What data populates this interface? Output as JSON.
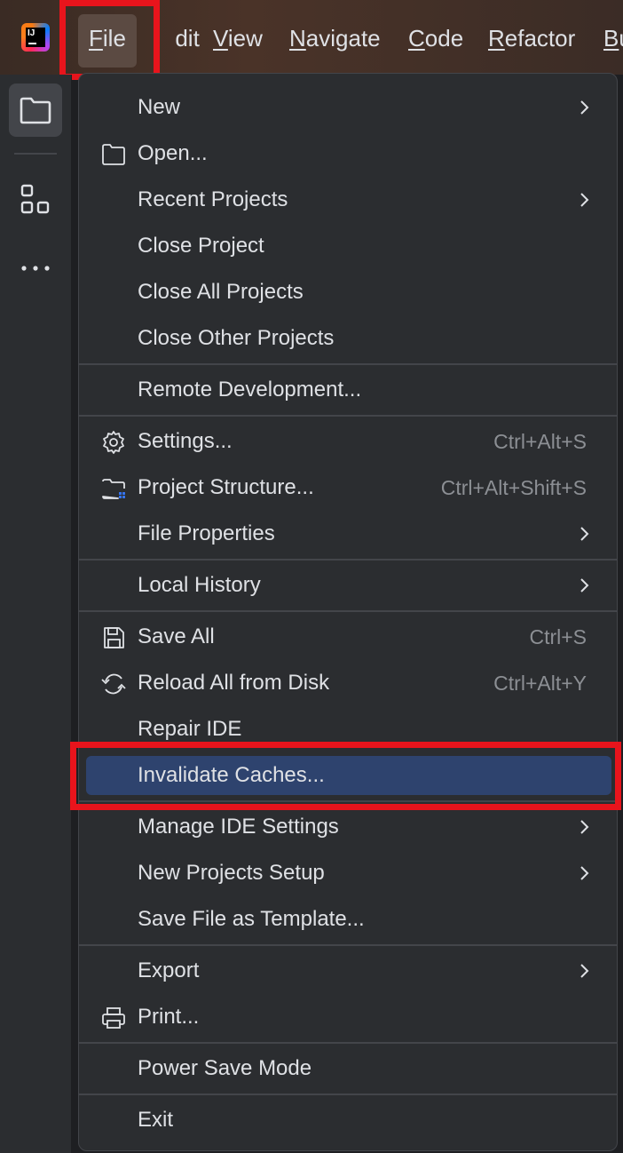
{
  "menubar": {
    "items": [
      {
        "label": "File",
        "mnemonic_index": 0
      },
      {
        "label": "Edit",
        "mnemonic_index": 0
      },
      {
        "label": "View",
        "mnemonic_index": 0
      },
      {
        "label": "Navigate",
        "mnemonic_index": 0
      },
      {
        "label": "Code",
        "mnemonic_index": 0
      },
      {
        "label": "Refactor",
        "mnemonic_index": 0
      },
      {
        "label": "Bu",
        "mnemonic_index": 0
      }
    ],
    "logo_text": "IJ"
  },
  "file_menu": {
    "groups": [
      [
        {
          "label": "New",
          "icon": null,
          "submenu": true,
          "shortcut": ""
        },
        {
          "label": "Open...",
          "icon": "folder-icon",
          "submenu": false,
          "shortcut": ""
        },
        {
          "label": "Recent Projects",
          "icon": null,
          "submenu": true,
          "shortcut": ""
        },
        {
          "label": "Close Project",
          "icon": null,
          "submenu": false,
          "shortcut": ""
        },
        {
          "label": "Close All Projects",
          "icon": null,
          "submenu": false,
          "shortcut": ""
        },
        {
          "label": "Close Other Projects",
          "icon": null,
          "submenu": false,
          "shortcut": ""
        }
      ],
      [
        {
          "label": "Remote Development...",
          "icon": null,
          "submenu": false,
          "shortcut": ""
        }
      ],
      [
        {
          "label": "Settings...",
          "icon": "gear-icon",
          "submenu": false,
          "shortcut": "Ctrl+Alt+S"
        },
        {
          "label": "Project Structure...",
          "icon": "project-structure-icon",
          "submenu": false,
          "shortcut": "Ctrl+Alt+Shift+S"
        },
        {
          "label": "File Properties",
          "icon": null,
          "submenu": true,
          "shortcut": ""
        }
      ],
      [
        {
          "label": "Local History",
          "icon": null,
          "submenu": true,
          "shortcut": ""
        }
      ],
      [
        {
          "label": "Save All",
          "icon": "save-icon",
          "submenu": false,
          "shortcut": "Ctrl+S"
        },
        {
          "label": "Reload All from Disk",
          "icon": "reload-icon",
          "submenu": false,
          "shortcut": "Ctrl+Alt+Y"
        },
        {
          "label": "Repair IDE",
          "icon": null,
          "submenu": false,
          "shortcut": ""
        },
        {
          "label": "Invalidate Caches...",
          "icon": null,
          "submenu": false,
          "shortcut": "",
          "selected": true
        }
      ],
      [
        {
          "label": "Manage IDE Settings",
          "icon": null,
          "submenu": true,
          "shortcut": ""
        },
        {
          "label": "New Projects Setup",
          "icon": null,
          "submenu": true,
          "shortcut": ""
        },
        {
          "label": "Save File as Template...",
          "icon": null,
          "submenu": false,
          "shortcut": ""
        }
      ],
      [
        {
          "label": "Export",
          "icon": null,
          "submenu": true,
          "shortcut": ""
        },
        {
          "label": "Print...",
          "icon": "print-icon",
          "submenu": false,
          "shortcut": ""
        }
      ],
      [
        {
          "label": "Power Save Mode",
          "icon": null,
          "submenu": false,
          "shortcut": ""
        }
      ],
      [
        {
          "label": "Exit",
          "icon": null,
          "submenu": false,
          "shortcut": ""
        }
      ]
    ]
  },
  "colors": {
    "menu_bg": "#2b2d30",
    "selection": "#2e436e",
    "annotation_red": "#e8141c",
    "shortcut_text": "#8c8f94"
  }
}
